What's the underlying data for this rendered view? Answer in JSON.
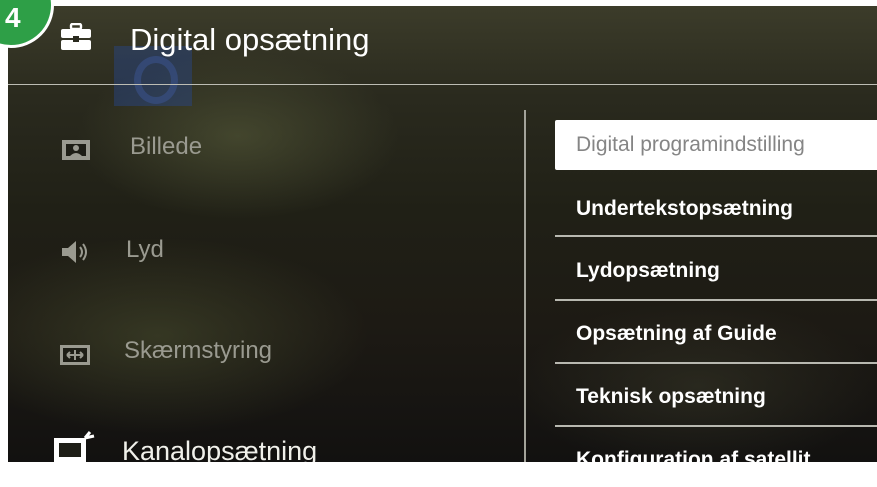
{
  "step_badge": "4",
  "header": {
    "title": "Digital opsætning",
    "icon": "toolbox-icon"
  },
  "left_menu": {
    "items": [
      {
        "label": "Billede",
        "icon": "picture-icon"
      },
      {
        "label": "Lyd",
        "icon": "speaker-icon"
      },
      {
        "label": "Skærmstyring",
        "icon": "screen-control-icon"
      },
      {
        "label": "Kanalopsætning",
        "icon": "tv-antenna-icon"
      }
    ]
  },
  "right_menu": {
    "selected_index": 0,
    "items": [
      {
        "label": "Digital programindstilling"
      },
      {
        "label": "Undertekstopsætning"
      },
      {
        "label": "Lydopsætning"
      },
      {
        "label": "Opsætning af Guide"
      },
      {
        "label": "Teknisk opsætning"
      },
      {
        "label": "Konfiguration af satellit"
      }
    ]
  },
  "colors": {
    "badge": "#2e9f47",
    "text_primary": "#ffffff",
    "text_dim": "#9a9a90",
    "selected_bg": "#ffffff",
    "selected_text": "#858585"
  }
}
